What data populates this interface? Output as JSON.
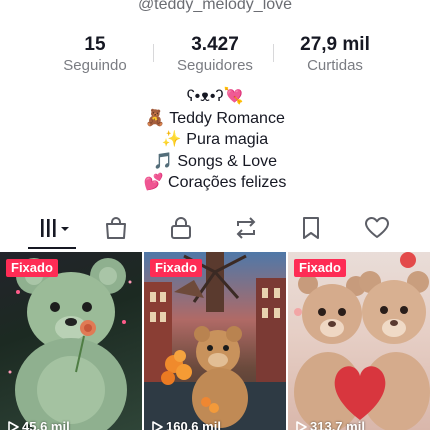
{
  "profile": {
    "username": "@teddy_melody_love"
  },
  "stats": [
    {
      "value": "15",
      "label": "Seguindo"
    },
    {
      "value": "3.427",
      "label": "Seguidores"
    },
    {
      "value": "27,9 mil",
      "label": "Curtidas"
    }
  ],
  "bio": {
    "line1": "ʕ•ᴥ•ʔ💘",
    "line2": "🧸 Teddy Romance",
    "line3": "✨ Pura magia",
    "line4": "🎵 Songs & Love",
    "line5": "💕 Corações felizes"
  },
  "tabs": [
    {
      "icon": "grid-bars-icon",
      "active": true
    },
    {
      "icon": "shopping-bag-icon",
      "active": false
    },
    {
      "icon": "lock-icon",
      "active": false
    },
    {
      "icon": "repost-icon",
      "active": false
    },
    {
      "icon": "bookmark-icon",
      "active": false
    },
    {
      "icon": "heart-icon",
      "active": false
    }
  ],
  "videos": [
    {
      "pinned_label": "Fixado",
      "views": "45,6 mil"
    },
    {
      "pinned_label": "Fixado",
      "views": "160,6 mil"
    },
    {
      "pinned_label": "Fixado",
      "views": "313,7 mil"
    }
  ],
  "colors": {
    "accent": "#fe2c55",
    "text_primary": "#161823",
    "text_secondary": "#7a7c82"
  }
}
